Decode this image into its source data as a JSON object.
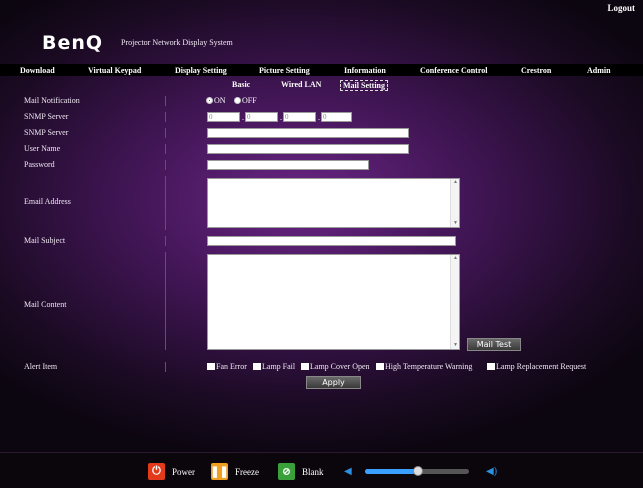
{
  "header": {
    "logout_label": "Logout",
    "brand": "BenQ",
    "subtitle": "Projector Network Display System"
  },
  "nav": {
    "items": [
      "Download",
      "Virtual Keypad",
      "Display Setting",
      "Picture Setting",
      "Information",
      "Conference Control",
      "Crestron",
      "Admin"
    ]
  },
  "subnav": {
    "items": [
      "Basic",
      "Wired LAN",
      "Mail Setting"
    ],
    "active": "Mail Setting"
  },
  "form": {
    "mail_notification": {
      "label": "Mail Notification",
      "on_label": "ON",
      "off_label": "OFF",
      "selected": "ON"
    },
    "snmp_server_ip": {
      "label": "SNMP Server",
      "octets": [
        "0",
        "0",
        "0",
        "0"
      ],
      "dot": "."
    },
    "snmp_server": {
      "label": "SNMP Server",
      "value": ""
    },
    "user_name": {
      "label": "User Name",
      "value": ""
    },
    "password": {
      "label": "Password",
      "value": ""
    },
    "email_address": {
      "label": "Email Address",
      "value": ""
    },
    "mail_subject": {
      "label": "Mail Subject",
      "value": ""
    },
    "mail_content": {
      "label": "Mail Content",
      "value": ""
    },
    "mail_test_label": "Mail Test",
    "alert_item": {
      "label": "Alert Item",
      "options": [
        "Fan Error",
        "Lamp Fail",
        "Lamp Cover Open",
        "High Temperature Warning",
        "Lamp Replacement Request"
      ]
    },
    "apply_label": "Apply"
  },
  "bottom": {
    "power_label": "Power",
    "freeze_label": "Freeze",
    "blank_label": "Blank",
    "volume_level": 0.5,
    "colors": {
      "power": "#e23a1a",
      "freeze": "#f0a020",
      "blank": "#3aa03a",
      "volume": "#3aa0ff"
    }
  }
}
